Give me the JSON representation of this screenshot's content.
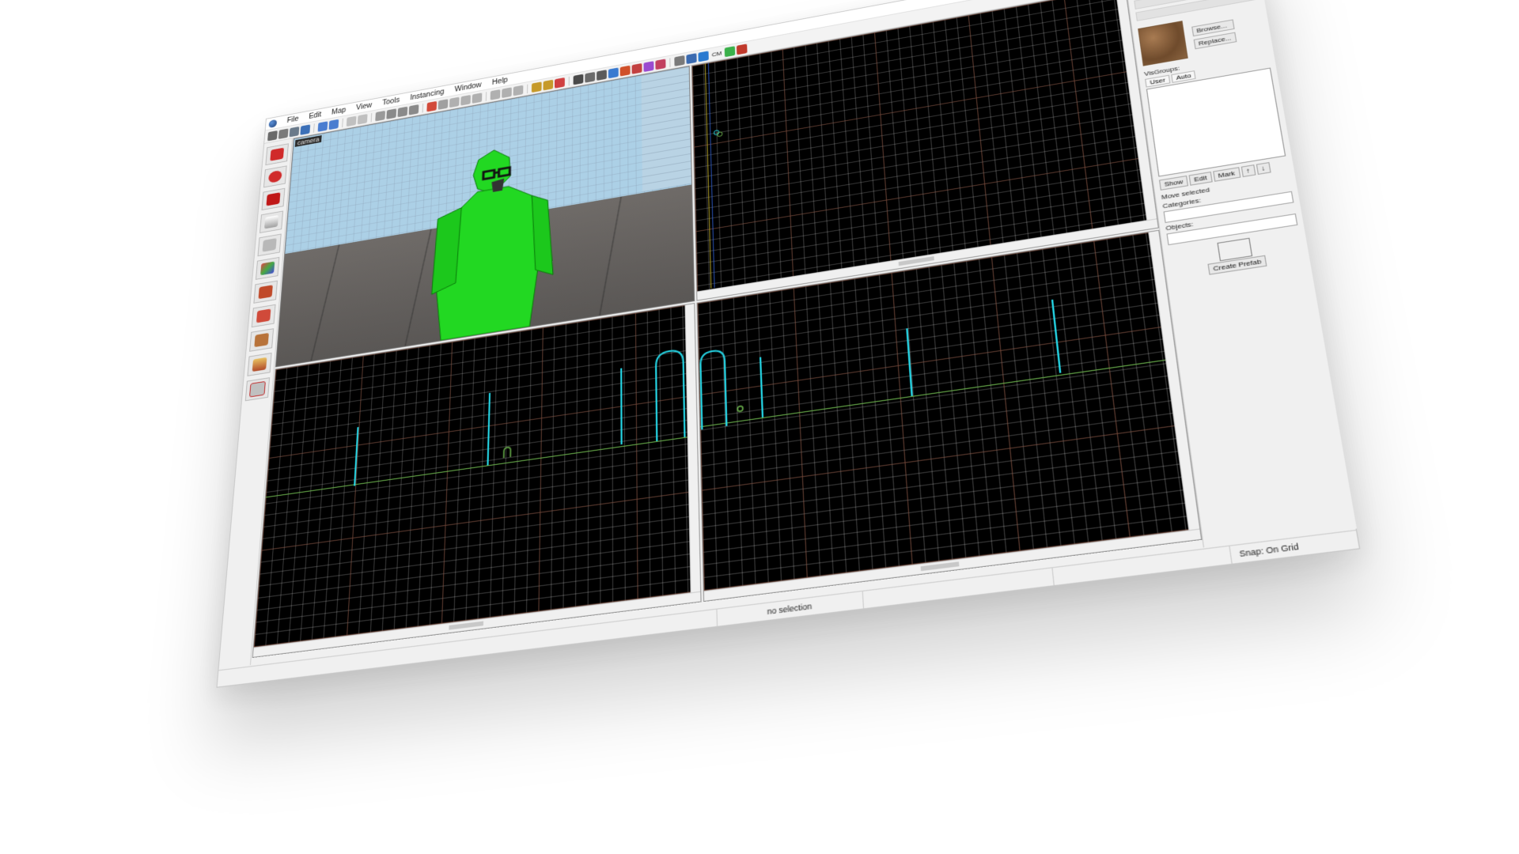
{
  "menu": {
    "items": [
      "File",
      "Edit",
      "Map",
      "View",
      "Tools",
      "Instancing",
      "Window",
      "Help"
    ]
  },
  "toolbar": {
    "text_buttons": [
      "CM"
    ]
  },
  "viewport": {
    "camera_label": "camera"
  },
  "sidepanel": {
    "visgroups_label": "VisGroups:",
    "tab_user": "User",
    "tab_auto": "Auto",
    "browse_label": "Browse...",
    "replace_label": "Replace...",
    "show_btn": "Show",
    "edit_btn": "Edit",
    "mark_btn": "Mark",
    "move_selected_label": "Move selected",
    "categories_label": "Categories:",
    "objects_label": "Objects:",
    "create_prefab_btn": "Create Prefab"
  },
  "status": {
    "selection": "no selection",
    "snap": "Snap: On Grid"
  }
}
